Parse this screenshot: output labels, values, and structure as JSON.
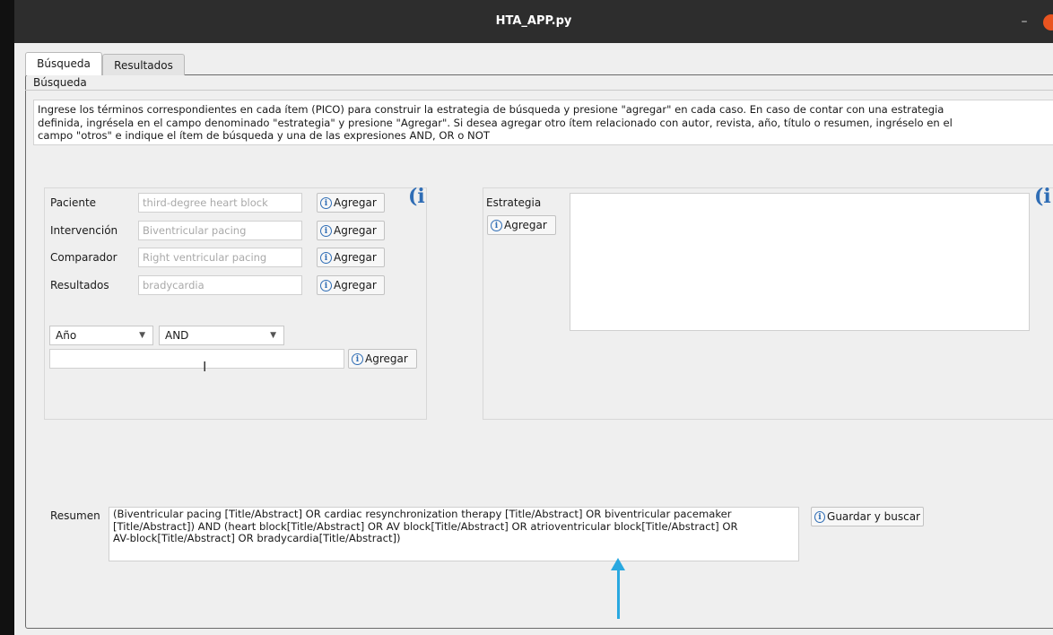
{
  "window": {
    "title": "HTA_APP.py",
    "minimize_glyph": "–",
    "close_color": "#e95420"
  },
  "tabs": [
    {
      "label": "Búsqueda",
      "selected": true
    },
    {
      "label": "Resultados",
      "selected": false
    }
  ],
  "group": {
    "title": "Búsqueda",
    "instructions": "Ingrese los términos correspondientes en cada ítem (PICO) para construir la estrategia de búsqueda y presione \"agregar\" en cada caso. En caso de contar con una estrategia\ndefinida, ingrésela en el campo denominado \"estrategia\" y presione \"Agregar\". Si desea agregar otro ítem relacionado con autor, revista, año, título o resumen, ingréselo en el\ncampo \"otros\" e indique el ítem de búsqueda y una de las expresiones AND, OR o NOT"
  },
  "pico": [
    {
      "label": "Paciente",
      "placeholder": "third-degree heart block",
      "button": "Agregar"
    },
    {
      "label": "Intervención",
      "placeholder": "Biventricular pacing",
      "button": "Agregar"
    },
    {
      "label": "Comparador",
      "placeholder": "Right ventricular pacing",
      "button": "Agregar"
    },
    {
      "label": "Resultados",
      "placeholder": "bradycardia",
      "button": "Agregar"
    }
  ],
  "otros": {
    "field_selected": "Año",
    "operator_selected": "AND",
    "value": "",
    "button": "Agregar"
  },
  "estrategia": {
    "label": "Estrategia",
    "button": "Agregar",
    "value": ""
  },
  "info_glyph": "i",
  "button_icon_glyph": "i",
  "resumen": {
    "label": "Resumen",
    "text": "(Biventricular pacing [Title/Abstract] OR cardiac resynchronization therapy [Title/Abstract] OR biventricular pacemaker\n[Title/Abstract]) AND (heart block[Title/Abstract] OR AV block[Title/Abstract] OR atrioventricular block[Title/Abstract] OR\nAV-block[Title/Abstract] OR bradycardia[Title/Abstract])",
    "button": "Guardar y buscar"
  },
  "annotation": {
    "arrow_color": "#29a8e0"
  }
}
